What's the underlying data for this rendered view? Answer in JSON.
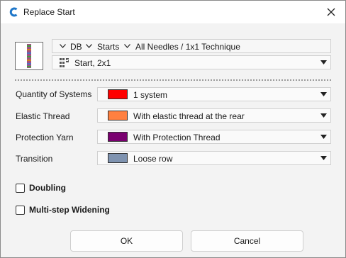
{
  "window": {
    "title": "Replace Start"
  },
  "breadcrumb": {
    "items": [
      "DB",
      "Starts",
      "All Needles / 1x1 Technique"
    ]
  },
  "start_select": {
    "value": "Start, 2x1"
  },
  "fields": [
    {
      "label": "Quantity of Systems",
      "value": "1 system",
      "color": "#ff0000"
    },
    {
      "label": "Elastic Thread",
      "value": "With elastic thread at the rear",
      "color": "#ff8040"
    },
    {
      "label": "Protection Yarn",
      "value": "With Protection Thread",
      "color": "#7a0070"
    },
    {
      "label": "Transition",
      "value": "Loose row",
      "color": "#7f93b0"
    }
  ],
  "options": [
    {
      "label": "Doubling",
      "checked": false
    },
    {
      "label": "Multi-step Widening",
      "checked": false
    }
  ],
  "buttons": {
    "ok": "OK",
    "cancel": "Cancel"
  },
  "icons": {
    "app": "app-logo-icon",
    "close": "close-icon",
    "start": "start-icon"
  },
  "accent_color": "#1f77c9"
}
